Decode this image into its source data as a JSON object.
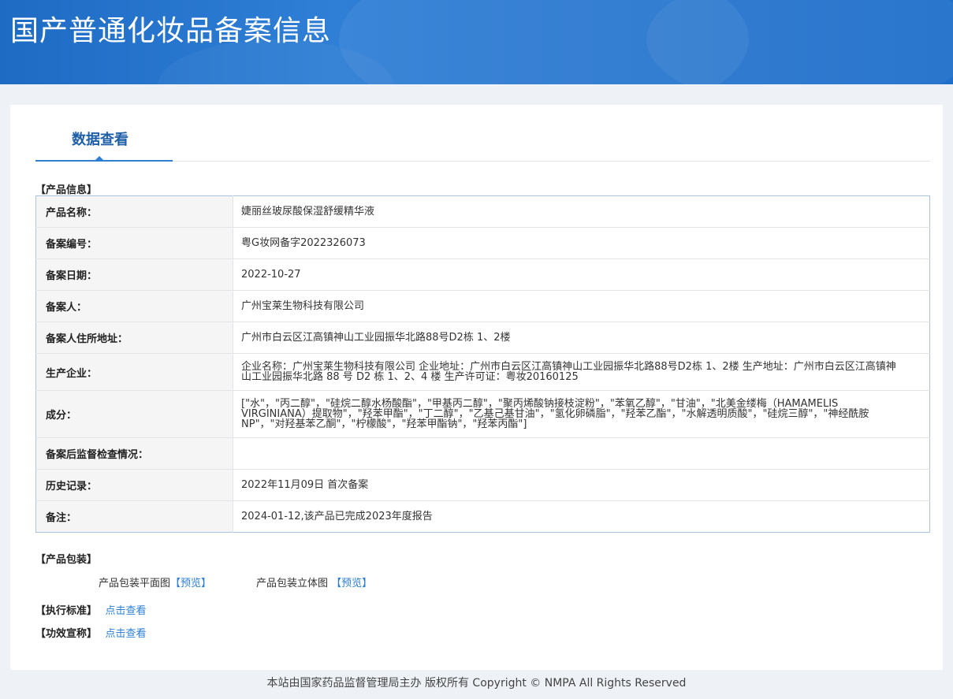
{
  "header": {
    "title": "国产普通化妆品备案信息"
  },
  "tab": {
    "label": "数据查看"
  },
  "product_info": {
    "section_title": "【产品信息】",
    "rows": [
      {
        "label": "产品名称：",
        "value": "婕丽丝玻尿酸保湿舒缓精华液"
      },
      {
        "label": "备案编号：",
        "value": "粤G妆网备字2022326073"
      },
      {
        "label": "备案日期：",
        "value": "2022-10-27"
      },
      {
        "label": "备案人：",
        "value": "广州宝莱生物科技有限公司"
      },
      {
        "label": "备案人住所地址：",
        "value": "广州市白云区江高镇神山工业园振华北路88号D2栋 1、2楼"
      },
      {
        "label": "生产企业：",
        "value": "企业名称：广州宝莱生物科技有限公司 企业地址：广州市白云区江高镇神山工业园振华北路88号D2栋 1、2楼 生产地址：广州市白云区江高镇神山工业园振华北路 88 号 D2 栋 1、2、4 楼 生产许可证：粤妆20160125"
      },
      {
        "label": "成分：",
        "value": "[\"水\"，\"丙二醇\"，\"硅烷二醇水杨酸酯\"，\"甲基丙二醇\"，\"聚丙烯酸钠接枝淀粉\"，\"苯氧乙醇\"，\"甘油\"，\"北美金缕梅（HAMAMELIS VIRGINIANA）提取物\"，\"羟苯甲酯\"，\"丁二醇\"，\"乙基己基甘油\"，\"氢化卵磷脂\"，\"羟苯乙酯\"，\"水解透明质酸\"，\"硅烷三醇\"，\"神经酰胺NP\"，\"对羟基苯乙酮\"，\"柠檬酸\"，\"羟苯甲酯钠\"，\"羟苯丙酯\"]"
      },
      {
        "label": "备案后监督检查情况：",
        "value": ""
      },
      {
        "label": "历史记录：",
        "value": "2022年11月09日 首次备案"
      },
      {
        "label": "备注：",
        "value": "2024-01-12,该产品已完成2023年度报告"
      }
    ]
  },
  "packaging": {
    "section_title": "【产品包装】",
    "flat_label": "产品包装平面图",
    "flat_link": "【预览】",
    "solid_label": "产品包装立体图",
    "solid_link": "【预览】"
  },
  "standard": {
    "section_title": "【执行标准】",
    "link": "点击查看"
  },
  "efficacy": {
    "section_title": "【功效宣称】",
    "link": "点击查看"
  },
  "footer": {
    "text": "本站由国家药品监督管理局主办 版权所有 Copyright © NMPA All Rights Reserved"
  }
}
